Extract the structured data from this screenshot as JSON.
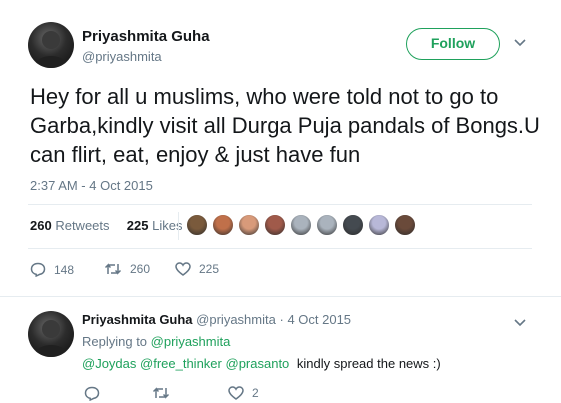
{
  "tweet": {
    "author_name": "Priyashmita Guha",
    "author_handle": "@priyashmita",
    "follow_label": "Follow",
    "text": "Hey for all u muslims, who were told not to go to Garba,kindly visit all Durga Puja pandals of Bongs.U can flirt, eat, enjoy & just have fun",
    "timestamp": "2:37 AM - 4 Oct 2015",
    "retweets_count": "260",
    "retweets_label": "Retweets",
    "likes_count": "225",
    "likes_label": "Likes",
    "actions": {
      "reply_count": "148",
      "retweet_count": "260",
      "like_count": "225"
    },
    "likers": [
      "#7a5a3c",
      "#c0704a",
      "#d89a7a",
      "#a05a4a",
      "#aab3bd",
      "#aab3bd",
      "#444a50",
      "#b8b8d8",
      "#6a4a3a"
    ]
  },
  "reply": {
    "author_name": "Priyashmita Guha",
    "author_handle": "@priyashmita",
    "separator": "·",
    "date": "4 Oct 2015",
    "replying_to_label": "Replying to",
    "replying_to_handle": "@priyashmita",
    "mentions": [
      "@Joydas",
      "@free_thinker",
      "@prasanto"
    ],
    "text": "kindly spread the news :)",
    "actions": {
      "reply_count": "",
      "retweet_count": "",
      "like_count": "2"
    }
  },
  "colors": {
    "accent": "#1fa15c",
    "secondary_text": "#657786",
    "primary_text": "#14171a",
    "divider": "#e6ecf0"
  }
}
